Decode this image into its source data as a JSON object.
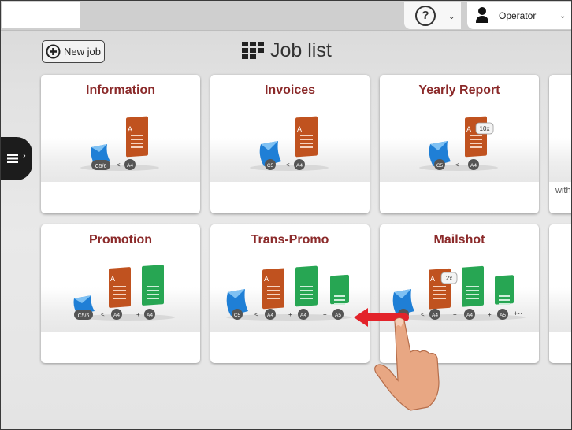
{
  "header": {
    "help_icon": "?",
    "user_label": "Operator"
  },
  "toolbar": {
    "new_job_label": "New job"
  },
  "page": {
    "title": "Job list"
  },
  "jobs": [
    {
      "title": "Information",
      "envelope": "C5/6",
      "inserts": [
        "A4"
      ],
      "multiplier": ""
    },
    {
      "title": "Invoices",
      "envelope": "C5",
      "inserts": [
        "A4"
      ],
      "multiplier": ""
    },
    {
      "title": "Yearly Report",
      "envelope": "C5",
      "inserts": [
        "A4"
      ],
      "multiplier": "10x"
    },
    {
      "title": "Promotion",
      "envelope": "C5/6",
      "inserts": [
        "A4",
        "A4"
      ],
      "multiplier": ""
    },
    {
      "title": "Trans-Promo",
      "envelope": "C5",
      "inserts": [
        "A4",
        "A4",
        "A5"
      ],
      "multiplier": ""
    },
    {
      "title": "Mailshot",
      "envelope": "C5",
      "inserts": [
        "A4",
        "A4",
        "A5"
      ],
      "multiplier": "2x"
    }
  ],
  "partial_card_text": "with",
  "colors": {
    "card_title": "#8b2a2a",
    "envelope": "#1f7fd6",
    "doc_main": "#c0521f",
    "doc_insert": "#27a653",
    "swipe_arrow": "#e3232a"
  }
}
